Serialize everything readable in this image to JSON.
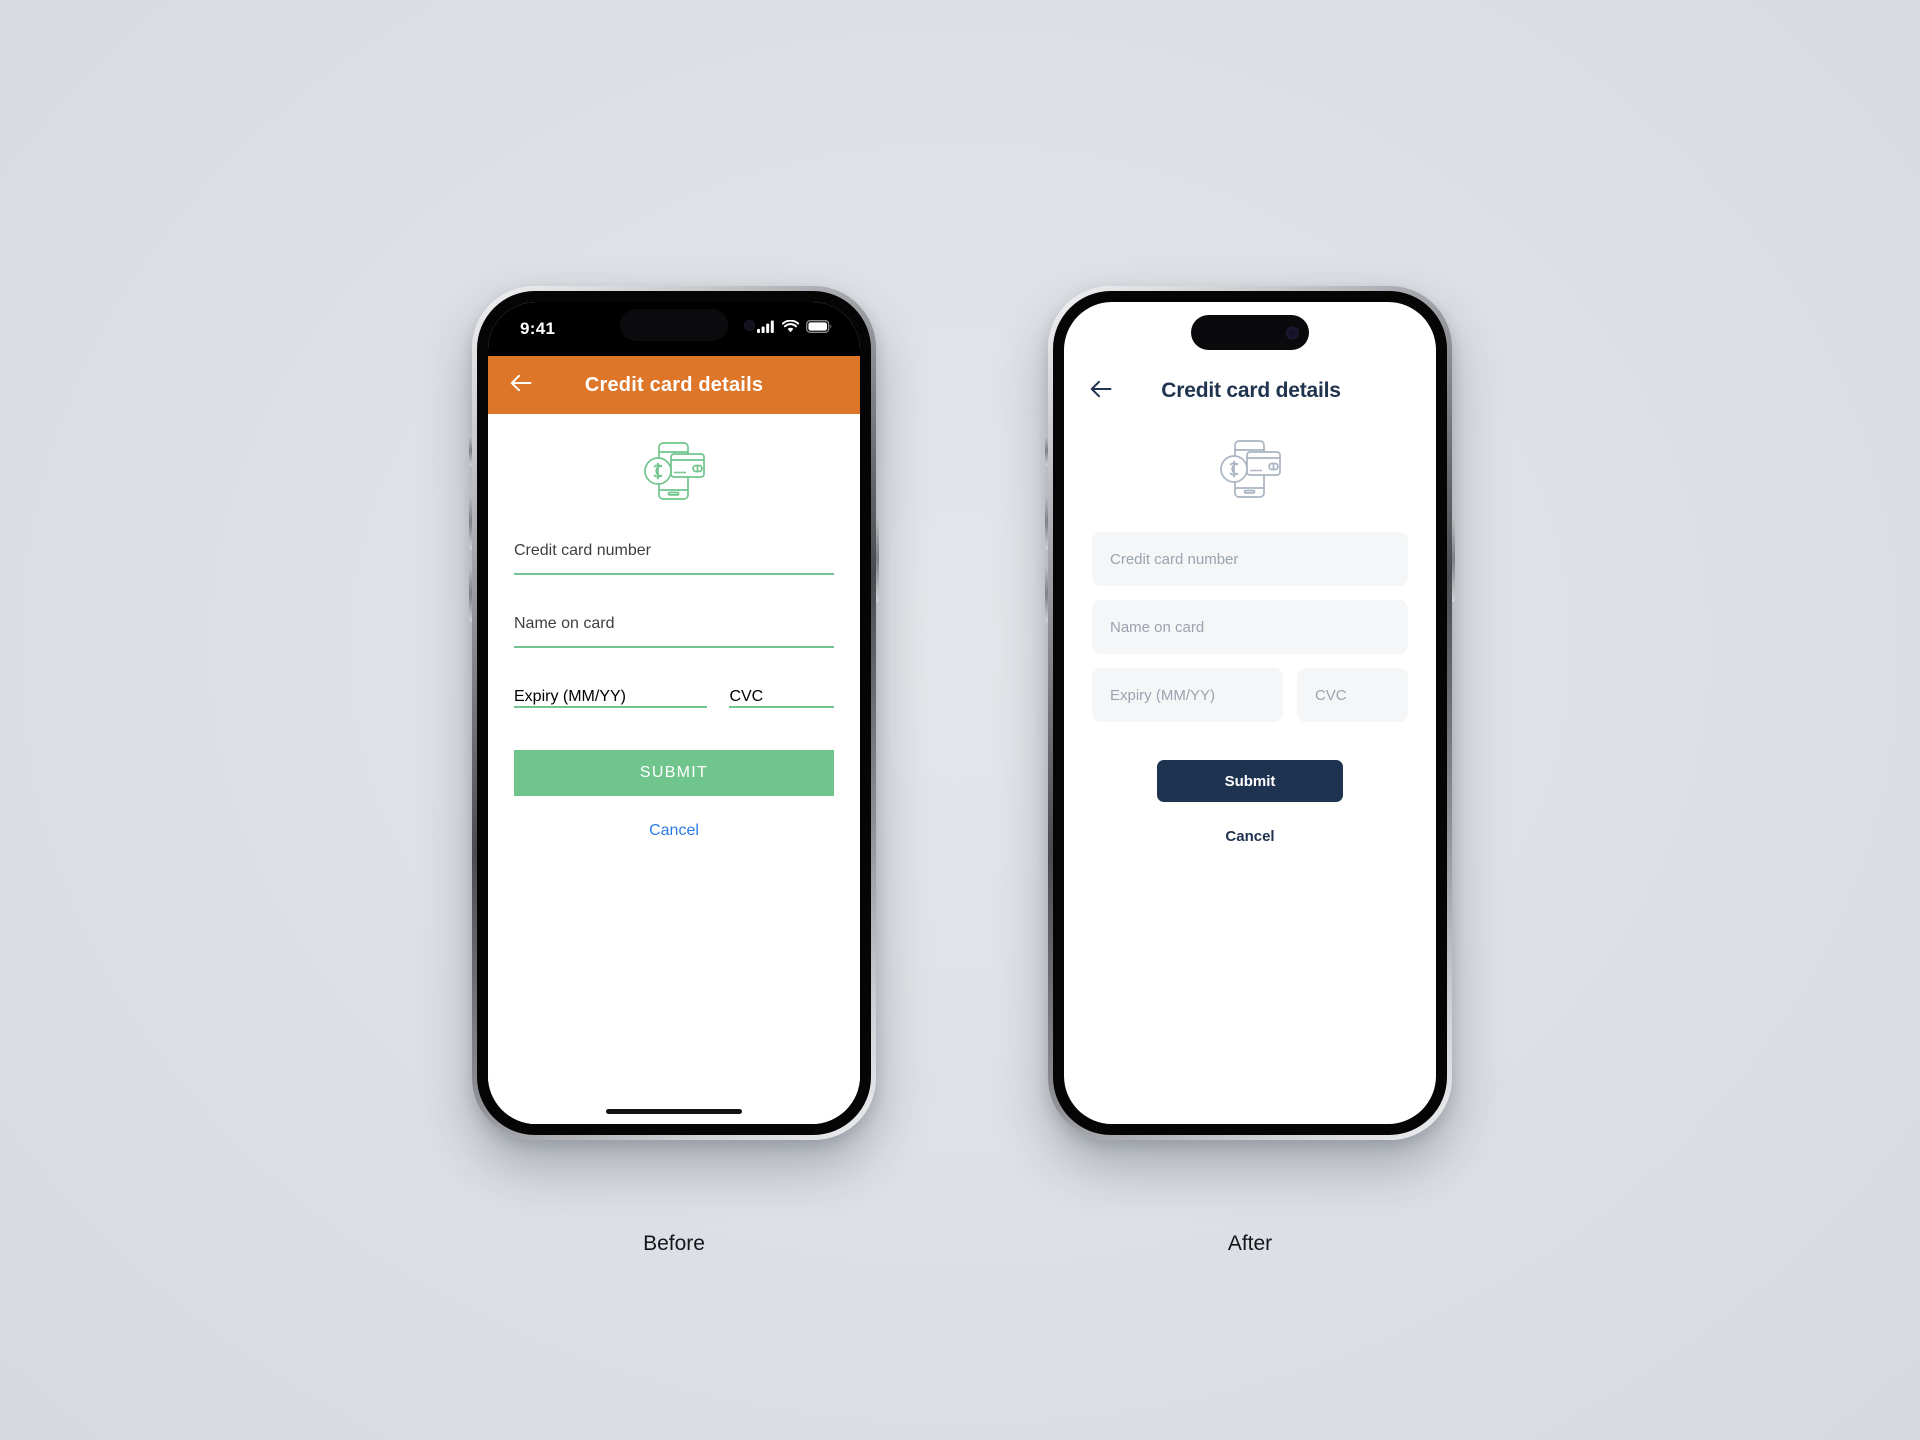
{
  "page": {
    "background_color": "#dfe2e6",
    "captions": {
      "before": "Before",
      "after": "After"
    }
  },
  "before_phone": {
    "status_bar": {
      "time": "9:41",
      "icons": [
        "cellular-signal-icon",
        "wifi-icon",
        "battery-icon"
      ]
    },
    "app_bar": {
      "background_color": "#dd7628",
      "title": "Credit card details",
      "back_icon": "arrow-left-icon"
    },
    "hero_icon": "card-payment-icon",
    "accent_color": "#6fc58c",
    "fields": [
      {
        "label": "Credit card number",
        "value": ""
      },
      {
        "label": "Name on card",
        "value": ""
      },
      {
        "label": "Expiry (MM/YY)",
        "value": ""
      },
      {
        "label": "CVC",
        "value": ""
      }
    ],
    "submit_label": "SUBMIT",
    "cancel_label": "Cancel",
    "cancel_color": "#2b7de9"
  },
  "after_phone": {
    "app_bar": {
      "title": "Credit card details",
      "back_icon": "arrow-left-icon",
      "title_color": "#20344f"
    },
    "hero_icon": "card-payment-icon",
    "accent_color": "#1e3350",
    "fields": [
      {
        "placeholder": "Credit card number",
        "value": ""
      },
      {
        "placeholder": "Name on card",
        "value": ""
      },
      {
        "placeholder": "Expiry (MM/YY)",
        "value": ""
      },
      {
        "placeholder": "CVC",
        "value": ""
      }
    ],
    "submit_label": "Submit",
    "cancel_label": "Cancel"
  }
}
